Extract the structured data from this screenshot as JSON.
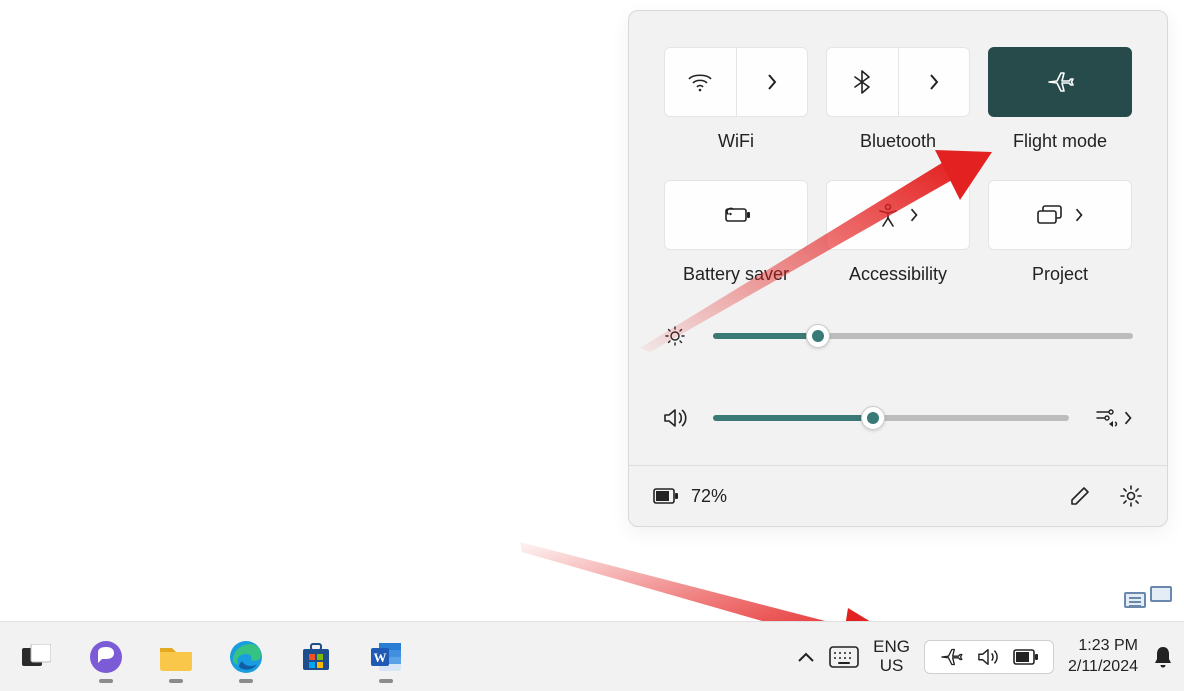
{
  "quick_settings": {
    "tiles": [
      {
        "id": "wifi",
        "label": "WiFi",
        "icon": "wifi-icon",
        "expandable": true,
        "active": false
      },
      {
        "id": "bluetooth",
        "label": "Bluetooth",
        "icon": "bluetooth-icon",
        "expandable": true,
        "active": false
      },
      {
        "id": "flight-mode",
        "label": "Flight mode",
        "icon": "airplane-icon",
        "expandable": false,
        "active": true
      },
      {
        "id": "battery-saver",
        "label": "Battery saver",
        "icon": "battery-saver-icon",
        "expandable": false,
        "active": false
      },
      {
        "id": "accessibility",
        "label": "Accessibility",
        "icon": "accessibility-icon",
        "expandable": true,
        "active": false
      },
      {
        "id": "project",
        "label": "Project",
        "icon": "project-icon",
        "expandable": true,
        "active": false
      }
    ],
    "brightness_percent": 25,
    "volume_percent": 45,
    "battery_percent_text": "72%"
  },
  "taskbar": {
    "language_top": "ENG",
    "language_bottom": "US",
    "time": "1:23 PM",
    "date": "2/11/2024"
  },
  "annotation": {
    "arrow1_desc": "Red arrow pointing to Flight mode tile",
    "arrow2_desc": "Red arrow pointing to system tray"
  },
  "colors": {
    "panel_bg": "#f2f2f2",
    "tile_bg": "#fefefe",
    "tile_active": "#274b4b",
    "slider_fill": "#3a7a76",
    "arrow": "#e42121"
  }
}
